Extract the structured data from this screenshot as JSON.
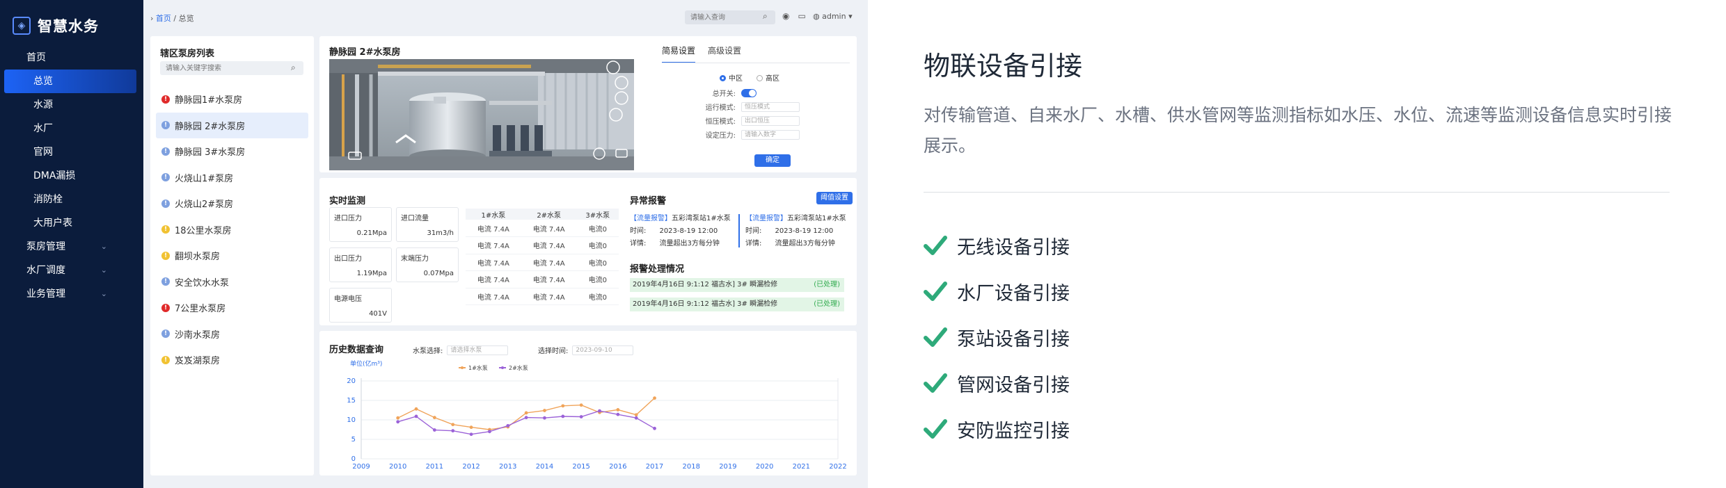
{
  "app": {
    "title": "智慧水务"
  },
  "sidebar": {
    "items": [
      {
        "label": "首页",
        "level": "top"
      },
      {
        "label": "总览",
        "level": "sub",
        "active": true
      },
      {
        "label": "水源",
        "level": "sub"
      },
      {
        "label": "水厂",
        "level": "sub"
      },
      {
        "label": "官网",
        "level": "sub"
      },
      {
        "label": "DMA漏损",
        "level": "sub"
      },
      {
        "label": "消防栓",
        "level": "sub"
      },
      {
        "label": "大用户表",
        "level": "sub"
      },
      {
        "label": "泵房管理",
        "level": "top",
        "expandable": true
      },
      {
        "label": "水厂调度",
        "level": "top",
        "expandable": true
      },
      {
        "label": "业务管理",
        "level": "top",
        "expandable": true
      }
    ]
  },
  "header": {
    "breadcrumb_home": "首页",
    "breadcrumb_sep": " / ",
    "breadcrumb_current": "总览",
    "search_placeholder": "请输入查询",
    "user": "admin ▾"
  },
  "pump_list": {
    "title": "辖区泵房列表",
    "search_placeholder": "请输入关键字搜索",
    "items": [
      {
        "name": "静脉园1#水泵房",
        "status": "red"
      },
      {
        "name": "静脉园 2#水泵房",
        "status": "blue",
        "selected": true
      },
      {
        "name": "静脉园 3#水泵房",
        "status": "blue"
      },
      {
        "name": "火烧山1#泵房",
        "status": "blue"
      },
      {
        "name": "火烧山2#泵房",
        "status": "blue"
      },
      {
        "name": "18公里水泵房",
        "status": "yellow"
      },
      {
        "name": "翻坝水泵房",
        "status": "yellow"
      },
      {
        "name": "安全饮水水泵",
        "status": "blue"
      },
      {
        "name": "7公里水泵房",
        "status": "red"
      },
      {
        "name": "沙南水泵房",
        "status": "blue"
      },
      {
        "name": "岌岌湖泵房",
        "status": "yellow"
      }
    ]
  },
  "camera": {
    "title": "静脉园 2#水泵房",
    "tabs": [
      "简易设置",
      "高级设置"
    ],
    "zone_options": [
      "中区",
      "高区"
    ],
    "fields": [
      {
        "label": "总开关:",
        "type": "toggle"
      },
      {
        "label": "运行模式:",
        "value": "恒压模式"
      },
      {
        "label": "恒压模式:",
        "value": "出口恒压"
      },
      {
        "label": "设定压力:",
        "value": "请输入数字"
      }
    ],
    "confirm_label": "确定"
  },
  "realtime": {
    "title": "实时监测",
    "metrics": [
      {
        "label": "进口压力",
        "value": "0.21Mpa"
      },
      {
        "label": "进口流量",
        "value": "31m3/h"
      },
      {
        "label": "出口压力",
        "value": "1.19Mpa"
      },
      {
        "label": "末端压力",
        "value": "0.07Mpa"
      },
      {
        "label": "电源电压",
        "value": "401V"
      }
    ],
    "table_headers": [
      "1#水泵",
      "2#水泵",
      "3#水泵"
    ],
    "table_rows": [
      [
        "电流 7.4A",
        "电流 7.4A",
        "电流0"
      ],
      [
        "电流 7.4A",
        "电流 7.4A",
        "电流0"
      ],
      [
        "电流 7.4A",
        "电流 7.4A",
        "电流0"
      ],
      [
        "电流 7.4A",
        "电流 7.4A",
        "电流0"
      ],
      [
        "电流 7.4A",
        "电流 7.4A",
        "电流0"
      ]
    ]
  },
  "alarm": {
    "title": "异常报警",
    "setting_button": "阈值设置",
    "entries": [
      {
        "tag": "【流量报警】",
        "station": "五彩湾泵站1#水泵",
        "time_label": "时间:",
        "time": "2023-8-19 12:00",
        "detail_label": "详情:",
        "detail": "流量超出3方每分钟"
      },
      {
        "tag": "【流量报警】",
        "station": "五彩湾泵站1#水泵",
        "time_label": "时间:",
        "time": "2023-8-19 12:00",
        "detail_label": "详情:",
        "detail": "流量超出3方每分钟"
      }
    ],
    "handling_title": "报警处理情况",
    "handling": [
      {
        "text": "2019年4月16日 9:1:12 福古水] 3# 瞬漏检修",
        "status": "(已处理)"
      },
      {
        "text": "2019年4月16日 9:1:12 福古水] 3# 瞬漏检修",
        "status": "(已处理)"
      }
    ]
  },
  "history": {
    "title": "历史数据查询",
    "pump_select_label": "水泵选择:",
    "pump_select_placeholder": "请选择水泵",
    "time_select_label": "选择时间:",
    "time_select_value": "2023-09-10"
  },
  "chart_data": {
    "type": "line",
    "ylabel": "单位(亿m³)",
    "x": [
      "2009",
      "2010",
      "2011",
      "2012",
      "2013",
      "2014",
      "2015",
      "2016",
      "2017",
      "2018",
      "2019",
      "2020",
      "2021",
      "2022"
    ],
    "ylim": [
      0,
      20
    ],
    "yticks": [
      "0",
      "5",
      "10",
      "15",
      "20"
    ],
    "grid": true,
    "legend": "top-left",
    "series": [
      {
        "name": "1#水泵",
        "color": "#f0a45a",
        "points": [
          [
            2010,
            10.5
          ],
          [
            2010.5,
            12.8
          ],
          [
            2011,
            10.6
          ],
          [
            2011.5,
            8.8
          ],
          [
            2012,
            8.1
          ],
          [
            2012.5,
            7.5
          ],
          [
            2013,
            8.2
          ],
          [
            2013.5,
            11.8
          ],
          [
            2014,
            12.4
          ],
          [
            2014.5,
            13.6
          ],
          [
            2015,
            13.8
          ],
          [
            2015.5,
            11.9
          ],
          [
            2016,
            12.6
          ],
          [
            2016.5,
            11.3
          ],
          [
            2017,
            15.6
          ]
        ]
      },
      {
        "name": "2#水泵",
        "color": "#9b62d8",
        "points": [
          [
            2010,
            9.5
          ],
          [
            2010.5,
            10.9
          ],
          [
            2011,
            7.4
          ],
          [
            2011.5,
            7.2
          ],
          [
            2012,
            6.3
          ],
          [
            2012.5,
            7.0
          ],
          [
            2013,
            8.5
          ],
          [
            2013.5,
            10.6
          ],
          [
            2014,
            10.5
          ],
          [
            2014.5,
            10.9
          ],
          [
            2015,
            10.8
          ],
          [
            2015.5,
            12.3
          ],
          [
            2016,
            11.4
          ],
          [
            2016.5,
            10.5
          ],
          [
            2017,
            7.8
          ]
        ]
      }
    ]
  },
  "feature": {
    "title": "物联设备引接",
    "description": "对传输管道、自来水厂、水槽、供水管网等监测指标如水压、水位、流速等监测设备信息实时引接展示。",
    "items": [
      "无线设备引接",
      "水厂设备引接",
      "泵站设备引接",
      "管网设备引接",
      "安防监控引接"
    ],
    "check_color": "#2eaa7a"
  }
}
